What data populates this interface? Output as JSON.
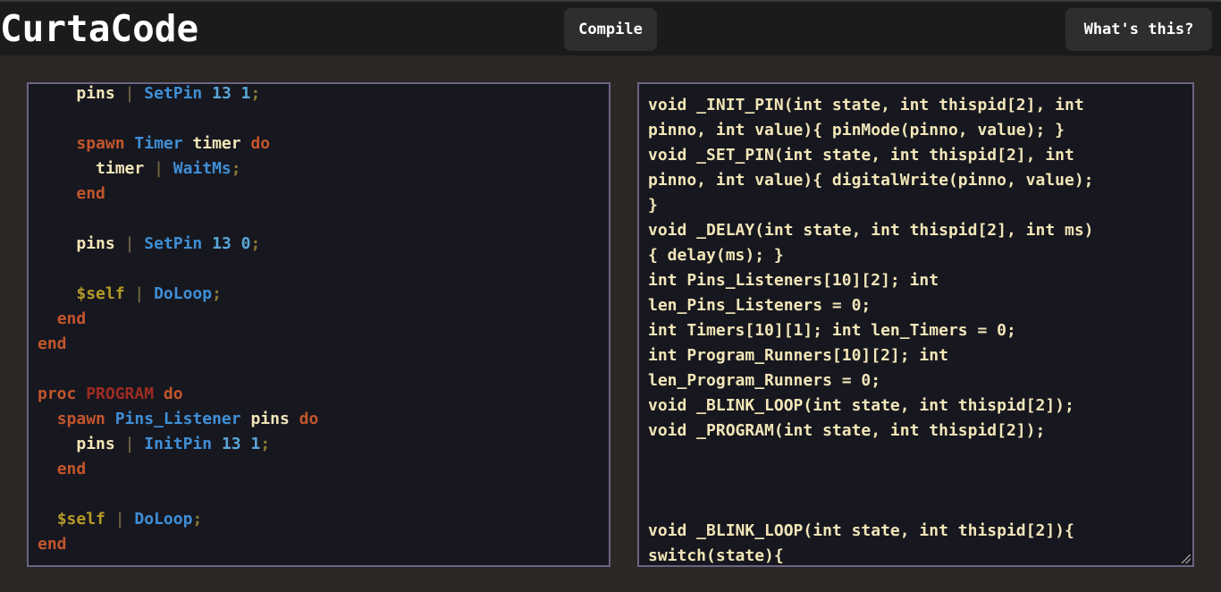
{
  "app": {
    "title": "CurtaCode",
    "compile_label": "Compile",
    "whats_this_label": "What's this?"
  },
  "editor": {
    "lines": [
      [
        {
          "t": "    "
        },
        {
          "t": "pins",
          "c": "var"
        },
        {
          "t": " "
        },
        {
          "t": "|",
          "c": "pipe"
        },
        {
          "t": " "
        },
        {
          "t": "SetPin",
          "c": "fn"
        },
        {
          "t": " "
        },
        {
          "t": "13",
          "c": "num"
        },
        {
          "t": " "
        },
        {
          "t": "1",
          "c": "num"
        },
        {
          "t": ";",
          "c": "punct"
        }
      ],
      [],
      [
        {
          "t": "    "
        },
        {
          "t": "spawn",
          "c": "kw"
        },
        {
          "t": " "
        },
        {
          "t": "Timer",
          "c": "ty"
        },
        {
          "t": " "
        },
        {
          "t": "timer",
          "c": "var"
        },
        {
          "t": " "
        },
        {
          "t": "do",
          "c": "kw"
        }
      ],
      [
        {
          "t": "      "
        },
        {
          "t": "timer",
          "c": "var"
        },
        {
          "t": " "
        },
        {
          "t": "|",
          "c": "pipe"
        },
        {
          "t": " "
        },
        {
          "t": "WaitMs",
          "c": "fn"
        },
        {
          "t": ";",
          "c": "punct"
        }
      ],
      [
        {
          "t": "    "
        },
        {
          "t": "end",
          "c": "kw"
        }
      ],
      [],
      [
        {
          "t": "    "
        },
        {
          "t": "pins",
          "c": "var"
        },
        {
          "t": " "
        },
        {
          "t": "|",
          "c": "pipe"
        },
        {
          "t": " "
        },
        {
          "t": "SetPin",
          "c": "fn"
        },
        {
          "t": " "
        },
        {
          "t": "13",
          "c": "num"
        },
        {
          "t": " "
        },
        {
          "t": "0",
          "c": "num"
        },
        {
          "t": ";",
          "c": "punct"
        }
      ],
      [],
      [
        {
          "t": "    "
        },
        {
          "t": "$self",
          "c": "self"
        },
        {
          "t": " "
        },
        {
          "t": "|",
          "c": "pipe"
        },
        {
          "t": " "
        },
        {
          "t": "DoLoop",
          "c": "fn"
        },
        {
          "t": ";",
          "c": "punct"
        }
      ],
      [
        {
          "t": "  "
        },
        {
          "t": "end",
          "c": "kw"
        }
      ],
      [
        {
          "t": "end",
          "c": "kw"
        }
      ],
      [],
      [
        {
          "t": "proc",
          "c": "kw"
        },
        {
          "t": " "
        },
        {
          "t": "PROGRAM",
          "c": "proc"
        },
        {
          "t": " "
        },
        {
          "t": "do",
          "c": "kw"
        }
      ],
      [
        {
          "t": "  "
        },
        {
          "t": "spawn",
          "c": "kw"
        },
        {
          "t": " "
        },
        {
          "t": "Pins_Listener",
          "c": "ty"
        },
        {
          "t": " "
        },
        {
          "t": "pins",
          "c": "var"
        },
        {
          "t": " "
        },
        {
          "t": "do",
          "c": "kw"
        }
      ],
      [
        {
          "t": "    "
        },
        {
          "t": "pins",
          "c": "var"
        },
        {
          "t": " "
        },
        {
          "t": "|",
          "c": "pipe"
        },
        {
          "t": " "
        },
        {
          "t": "InitPin",
          "c": "fn"
        },
        {
          "t": " "
        },
        {
          "t": "13",
          "c": "num"
        },
        {
          "t": " "
        },
        {
          "t": "1",
          "c": "num"
        },
        {
          "t": ";",
          "c": "punct"
        }
      ],
      [
        {
          "t": "  "
        },
        {
          "t": "end",
          "c": "kw"
        }
      ],
      [],
      [
        {
          "t": "  "
        },
        {
          "t": "$self",
          "c": "self"
        },
        {
          "t": " "
        },
        {
          "t": "|",
          "c": "pipe"
        },
        {
          "t": " "
        },
        {
          "t": "DoLoop",
          "c": "fn"
        },
        {
          "t": ";",
          "c": "punct"
        }
      ],
      [
        {
          "t": "end",
          "c": "kw"
        }
      ]
    ]
  },
  "output": {
    "text": "void _INIT_PIN(int state, int thispid[2], int\npinno, int value){ pinMode(pinno, value); }\nvoid _SET_PIN(int state, int thispid[2], int\npinno, int value){ digitalWrite(pinno, value);\n}\nvoid _DELAY(int state, int thispid[2], int ms)\n{ delay(ms); }\nint Pins_Listeners[10][2]; int\nlen_Pins_Listeners = 0;\nint Timers[10][1]; int len_Timers = 0;\nint Program_Runners[10][2]; int\nlen_Program_Runners = 0;\nvoid _BLINK_LOOP(int state, int thispid[2]);\nvoid _PROGRAM(int state, int thispid[2]);\n\n\n\nvoid _BLINK_LOOP(int state, int thispid[2]){\nswitch(state){"
  },
  "colors": {
    "background": "#2a2725",
    "topbar": "#1c1b1b",
    "panel": "#17171f",
    "panel_border": "#6b6483",
    "keyword": "#c2562d",
    "function": "#3f8fd6",
    "text": "#f2e6b8"
  }
}
